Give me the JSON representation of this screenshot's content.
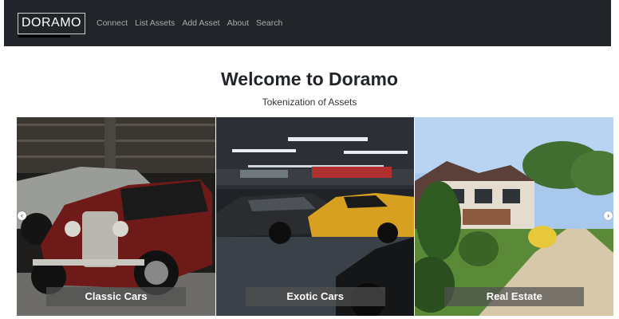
{
  "navbar": {
    "brand": "DORAMO",
    "links": [
      "Connect",
      "List Assets",
      "Add Asset",
      "About",
      "Search"
    ]
  },
  "hero": {
    "title": "Welcome to Doramo",
    "subtitle": "Tokenization of Assets"
  },
  "carousel": {
    "slides": [
      {
        "caption": "Classic Cars"
      },
      {
        "caption": "Exotic Cars"
      },
      {
        "caption": "Real Estate"
      }
    ],
    "prev_icon": "chevron-left-icon",
    "next_icon": "chevron-right-icon"
  },
  "colors": {
    "navbar_bg": "#212529",
    "nav_link": "#a9abae",
    "heading": "#212529"
  }
}
